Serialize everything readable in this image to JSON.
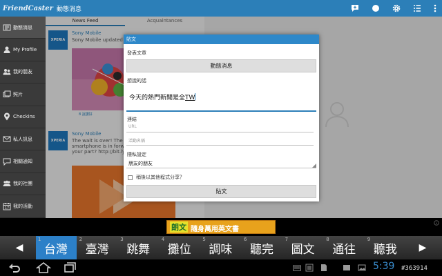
{
  "app": {
    "brand": "FriendCaster",
    "title": "動態消息"
  },
  "sidebar": {
    "items": [
      {
        "label": "動態消息",
        "icon": "news-icon"
      },
      {
        "label": "My Profile",
        "icon": "profile-icon"
      },
      {
        "label": "我的朋友",
        "icon": "friends-icon"
      },
      {
        "label": "照片",
        "icon": "photos-icon"
      },
      {
        "label": "Checkins",
        "icon": "checkin-icon"
      },
      {
        "label": "私人訊息",
        "icon": "messages-icon"
      },
      {
        "label": "相關通知",
        "icon": "notifications-icon"
      },
      {
        "label": "我的社團",
        "icon": "groups-icon"
      },
      {
        "label": "我的活動",
        "icon": "events-icon"
      }
    ]
  },
  "feed": {
    "tabs": [
      "News Feed",
      "Acquaintances"
    ],
    "posts": [
      {
        "avatar": "XPERIA",
        "author": "Sony Mobile",
        "text": "Sony Mobile updated the",
        "likes": "8 說讚好"
      },
      {
        "avatar": "XPERIA",
        "author": "Sony Mobile",
        "text": "The wait is over! The and Xperia smartphone is in forward time & get your your part? http://bit.ly/X"
      }
    ]
  },
  "dialog": {
    "title": "貼文",
    "post_to_label": "發表文章",
    "target_button": "動態消息",
    "say_label": "想說的話",
    "message": "今天的熱門新聞是全",
    "message_tail": "TW",
    "link_label": "連結",
    "url_placeholder": "URL",
    "event_placeholder": "活動名稱",
    "privacy_label": "隱私設定",
    "privacy_value": "朋友的朋友",
    "share_later": "稍後以其他程式分享？",
    "submit_button": "貼文"
  },
  "ad": {
    "keyword": "朗文",
    "text": "隨身萬用英文書"
  },
  "ime": {
    "candidates": [
      {
        "num": "1",
        "text": "台灣"
      },
      {
        "num": "2",
        "text": "臺灣"
      },
      {
        "num": "3",
        "text": "跳舞"
      },
      {
        "num": "4",
        "text": "攤位"
      },
      {
        "num": "5",
        "text": "調味"
      },
      {
        "num": "6",
        "text": "聽完"
      },
      {
        "num": "7",
        "text": "圖文"
      },
      {
        "num": "8",
        "text": "通往"
      },
      {
        "num": "9",
        "text": "聽我"
      }
    ],
    "selected_index": 0
  },
  "status": {
    "time": "5:39",
    "watermark": "#363914"
  },
  "colors": {
    "accent": "#2c7fb8",
    "ime_selected": "#2c80c8",
    "sidebar": "#3a3a3a"
  }
}
